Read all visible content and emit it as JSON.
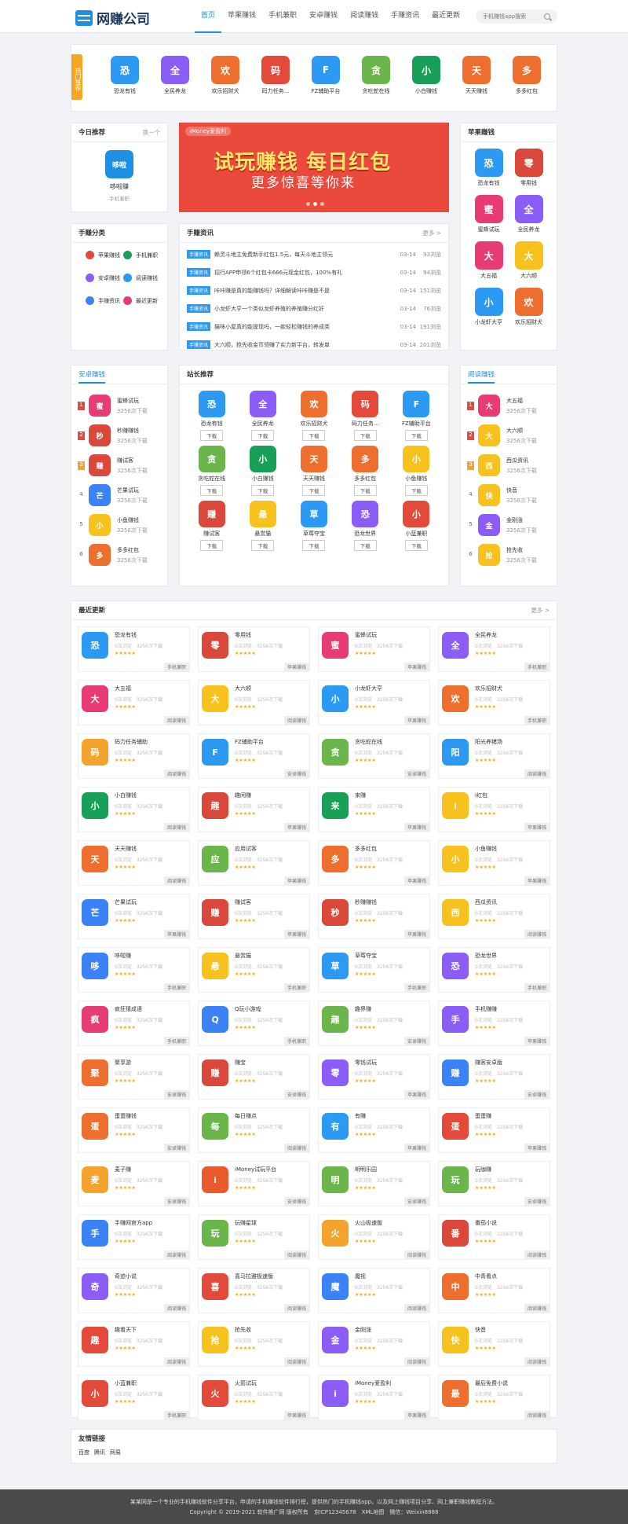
{
  "site": {
    "logo": "网赚公司",
    "search_placeholder": "手机赚钱app搜索"
  },
  "nav": [
    "首页",
    "苹果赚钱",
    "手机兼职",
    "安卓赚钱",
    "阅读赚钱",
    "手赚资讯",
    "最近更新"
  ],
  "hot": {
    "tag": "热门推荐",
    "items": [
      "恐龙有钱",
      "全民养龙",
      "欢乐招财犬",
      "码力任务...",
      "FZ辅助平台",
      "贪吃蛇在线",
      "小白赚钱",
      "天天赚钱",
      "多多红包"
    ]
  },
  "today": {
    "title": "今日推荐",
    "more": "换一个",
    "icon": "哆啦",
    "app": "哆啦赚",
    "cat": "手机兼职"
  },
  "banner": {
    "label": "iMoney爱盈利",
    "line1a": "试玩赚钱",
    "line1b": "每日红包",
    "line2": "更多惊喜等你来"
  },
  "apple": {
    "title": "苹果赚钱",
    "items": [
      "恐龙有钱",
      "零用钱",
      "蜜蜂试玩",
      "全民养龙",
      "大五福",
      "大六顺",
      "小龙虾大亨",
      "欢乐招财犬"
    ]
  },
  "cats": {
    "title": "手赚分类",
    "items": [
      "苹果赚钱",
      "手机兼职",
      "安卓赚钱",
      "阅读赚钱",
      "手赚资讯",
      "最近更新"
    ]
  },
  "news": {
    "title": "手赚资讯",
    "more": "更多 >",
    "items": [
      {
        "tag": "手赚资讯",
        "t": "赖灵斗地主免费新手红包1.5元，每天斗地主领元",
        "d": "03-14",
        "v": "93浏览"
      },
      {
        "tag": "手赚资讯",
        "t": "招行APP申领6个红包卡666元现金红包，100%有礼",
        "d": "03-14",
        "v": "94浏览"
      },
      {
        "tag": "手赚资讯",
        "t": "咔咔赚是真的能赚钱吗？详细解读咔咔赚是不是",
        "d": "03-14",
        "v": "151浏览"
      },
      {
        "tag": "手赚资讯",
        "t": "小龙虾大亨一个类似龙虾养殖的养殖赚分红奸",
        "d": "03-14",
        "v": "76浏览"
      },
      {
        "tag": "手赚资讯",
        "t": "猫咪小屋真的能提现吗，一款轻松赚钱的养成类",
        "d": "03-14",
        "v": "191浏览"
      },
      {
        "tag": "手赚资讯",
        "t": "大六顺，抢先收金币领赚了实力新平台，转发单",
        "d": "03-14",
        "v": "201浏览"
      }
    ]
  },
  "android": {
    "title": "安卓赚钱",
    "items": [
      {
        "n": "蜜蜂试玩",
        "c": "3256次下载"
      },
      {
        "n": "秒赚赚钱",
        "c": "3256次下载"
      },
      {
        "n": "赚试客",
        "c": "3256次下载"
      },
      {
        "n": "芒果试玩",
        "c": "3256次下载"
      },
      {
        "n": "小鱼赚钱",
        "c": "3256次下载"
      },
      {
        "n": "多多红包",
        "c": "3256次下载"
      }
    ]
  },
  "reading": {
    "title": "阅读赚钱",
    "items": [
      {
        "n": "大五福",
        "c": "3256次下载"
      },
      {
        "n": "大六顺",
        "c": "3256次下载"
      },
      {
        "n": "西瓜资讯",
        "c": "3256次下载"
      },
      {
        "n": "快音",
        "c": "3256次下载"
      },
      {
        "n": "金刚涨",
        "c": "3256次下载"
      },
      {
        "n": "抢先收",
        "c": "3256次下载"
      }
    ]
  },
  "zhanzhang": {
    "title": "站长推荐",
    "download": "下载",
    "items": [
      "恐龙有钱",
      "全民养龙",
      "欢乐招财犬",
      "码力任务...",
      "FZ辅助平台",
      "贪吃蛇在线",
      "小白赚钱",
      "天天赚钱",
      "多多红包",
      "小鱼赚钱",
      "赚试客",
      "悬赏猫",
      "草莓夺宝",
      "恐龙世界",
      "小蓝兼职"
    ]
  },
  "latest": {
    "title": "最近更新",
    "more": "更多 >",
    "meta": "0次浏览　3256次下载",
    "stars": "★★★★★",
    "items": [
      {
        "n": "恐龙有钱",
        "t": "手机兼职"
      },
      {
        "n": "零用钱",
        "t": "苹果赚钱"
      },
      {
        "n": "蜜蜂试玩",
        "t": "苹果赚钱"
      },
      {
        "n": "全民养龙",
        "t": "手机兼职"
      },
      {
        "n": "大五福",
        "t": "阅读赚钱"
      },
      {
        "n": "大六顺",
        "t": "阅读赚钱"
      },
      {
        "n": "小龙虾大亨",
        "t": "苹果赚钱"
      },
      {
        "n": "欢乐招财犬",
        "t": "手机兼职"
      },
      {
        "n": "码力任务辅助",
        "t": "阅读赚钱"
      },
      {
        "n": "FZ辅助平台",
        "t": "安卓赚钱"
      },
      {
        "n": "贪吃蛇在线",
        "t": "安卓赚钱"
      },
      {
        "n": "阳光养猪场",
        "t": "阅读赚钱"
      },
      {
        "n": "小白赚钱",
        "t": "阅读赚钱"
      },
      {
        "n": "趣闲赚",
        "t": "苹果赚钱"
      },
      {
        "n": "来赚",
        "t": "苹果赚钱"
      },
      {
        "n": "i红包",
        "t": "苹果赚钱"
      },
      {
        "n": "天天赚钱",
        "t": "阅读赚钱"
      },
      {
        "n": "应用试客",
        "t": "苹果赚钱"
      },
      {
        "n": "多多红包",
        "t": "苹果赚钱"
      },
      {
        "n": "小鱼赚钱",
        "t": "苹果赚钱"
      },
      {
        "n": "芒果试玩",
        "t": "苹果赚钱"
      },
      {
        "n": "赚试客",
        "t": "苹果赚钱"
      },
      {
        "n": "秒赚赚钱",
        "t": "苹果赚钱"
      },
      {
        "n": "西瓜资讯",
        "t": "阅读赚钱"
      },
      {
        "n": "哆啦赚",
        "t": "手机兼职"
      },
      {
        "n": "悬赏猫",
        "t": "手机兼职"
      },
      {
        "n": "草莓夺宝",
        "t": "手机兼职"
      },
      {
        "n": "恐龙世界",
        "t": "手机兼职"
      },
      {
        "n": "疯狂猜成语",
        "t": "手机兼职"
      },
      {
        "n": "Q玩小游戏",
        "t": "手机兼职"
      },
      {
        "n": "趣界赚",
        "t": "安卓赚钱"
      },
      {
        "n": "手机赚赚",
        "t": "苹果赚钱"
      },
      {
        "n": "聚享游",
        "t": "安卓赚钱"
      },
      {
        "n": "赚宝",
        "t": "安卓赚钱"
      },
      {
        "n": "零钱试玩",
        "t": "苹果赚钱"
      },
      {
        "n": "赚客安卓版",
        "t": "安卓赚钱"
      },
      {
        "n": "蛋蛋赚钱",
        "t": "安卓赚钱"
      },
      {
        "n": "每日赚点",
        "t": "阅读赚钱"
      },
      {
        "n": "有赚",
        "t": "苹果赚钱"
      },
      {
        "n": "蛋蛋赚",
        "t": "苹果赚钱"
      },
      {
        "n": "麦子赚",
        "t": "安卓赚钱"
      },
      {
        "n": "iMoney试玩平台",
        "t": "安卓赚钱"
      },
      {
        "n": "明明乐园",
        "t": "安卓赚钱"
      },
      {
        "n": "玩咖赚",
        "t": "安卓赚钱"
      },
      {
        "n": "手赚网官方app",
        "t": "阅读赚钱"
      },
      {
        "n": "玩赚星球",
        "t": "阅读赚钱"
      },
      {
        "n": "火山极速版",
        "t": "阅读赚钱"
      },
      {
        "n": "番茄小说",
        "t": "阅读赚钱"
      },
      {
        "n": "奇迹小说",
        "t": "阅读赚钱"
      },
      {
        "n": "喜马拉雅极速版",
        "t": "阅读赚钱"
      },
      {
        "n": "魔视",
        "t": "阅读赚钱"
      },
      {
        "n": "中青看点",
        "t": "阅读赚钱"
      },
      {
        "n": "趣看天下",
        "t": "阅读赚钱"
      },
      {
        "n": "抢先收",
        "t": "阅读赚钱"
      },
      {
        "n": "金刚涨",
        "t": "阅读赚钱"
      },
      {
        "n": "快音",
        "t": "阅读赚钱"
      },
      {
        "n": "小蓝兼职",
        "t": "手机兼职"
      },
      {
        "n": "火箭试玩",
        "t": "苹果赚钱"
      },
      {
        "n": "iMoney爱盈利",
        "t": "苹果赚钱"
      },
      {
        "n": "最后免费小说",
        "t": "阅读赚钱"
      }
    ]
  },
  "links": {
    "title": "友情链接",
    "items": [
      "百度",
      "腾讯",
      "网易"
    ]
  },
  "footer": {
    "line1": "某某网是一个专业的手机赚钱软件分享平台，申请的手机赚钱软件排行榜，提供热门的手机赚钱app，以及网上赚钱项目分享、网上兼职赚钱教程方法。",
    "line2": "Copyright © 2019-2021 软件推广网 版权所有　京ICP12345678　XML地图　微信：Weixin8888"
  }
}
